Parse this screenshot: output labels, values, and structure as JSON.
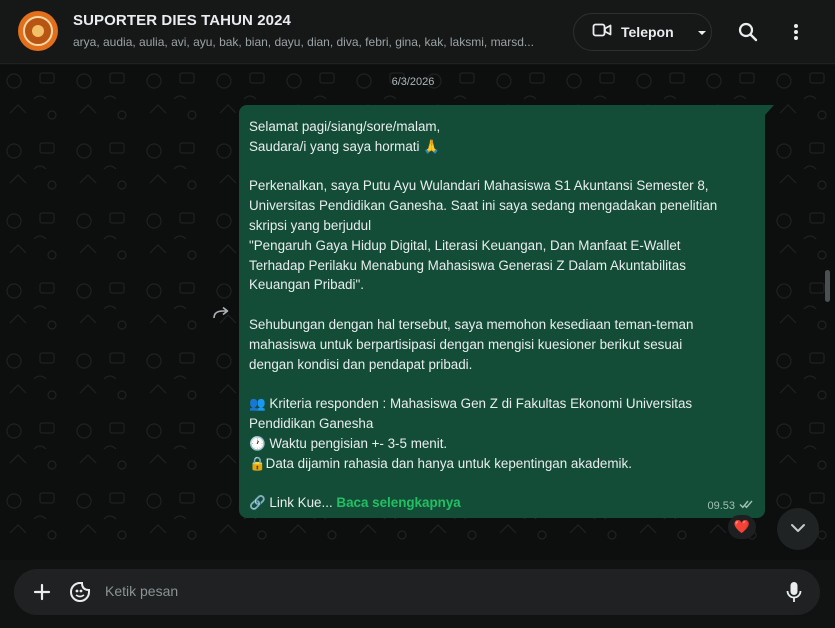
{
  "header": {
    "title": "SUPORTER DIES TAHUN 2024",
    "members": "arya, audia, aulia, avi, ayu, bak, bian, dayu, dian, diva, febri, gina, kak, laksmi, marsd...",
    "call_label": "Telepon"
  },
  "chat": {
    "date": "6/3/2026",
    "message": {
      "lines": [
        "Selamat pagi/siang/sore/malam,",
        "Saudara/i yang saya hormati 🙏",
        "",
        "Perkenalkan, saya Putu Ayu Wulandari Mahasiswa S1 Akuntansi Semester 8,",
        "Universitas Pendidikan Ganesha. Saat ini saya sedang mengadakan penelitian",
        "skripsi yang berjudul",
        "\"Pengaruh Gaya Hidup Digital, Literasi Keuangan, Dan Manfaat E-Wallet",
        "Terhadap Perilaku Menabung Mahasiswa Generasi Z Dalam Akuntabilitas",
        "Keuangan Pribadi\".",
        "",
        "Sehubungan dengan hal tersebut, saya memohon kesediaan teman-teman",
        "mahasiswa untuk berpartisipasi dengan mengisi kuesioner berikut sesuai",
        "dengan kondisi dan pendapat pribadi.",
        "",
        "👥 Kriteria responden : Mahasiswa Gen Z di Fakultas Ekonomi Universitas",
        "Pendidikan Ganesha",
        "🕐 Waktu pengisian +- 3-5 menit.",
        "🔒Data dijamin rahasia dan hanya untuk kepentingan akademik.",
        ""
      ],
      "link_prefix": "🔗 Link Kue...",
      "read_more": "Baca selengkapnya",
      "time": "09.53",
      "reaction": "❤️"
    }
  },
  "composer": {
    "placeholder": "Ketik pesan"
  },
  "colors": {
    "bubble": "#144d37",
    "accent": "#21c063",
    "header_bg": "#161717",
    "chat_bg": "#0d0f0f"
  },
  "icons": [
    "group-avatar",
    "video-camera-icon",
    "chevron-down-icon",
    "search-icon",
    "more-vertical-icon",
    "forward-icon",
    "double-check-icon",
    "heart-reaction",
    "arrow-down-icon",
    "plus-icon",
    "sticker-icon",
    "microphone-icon"
  ]
}
